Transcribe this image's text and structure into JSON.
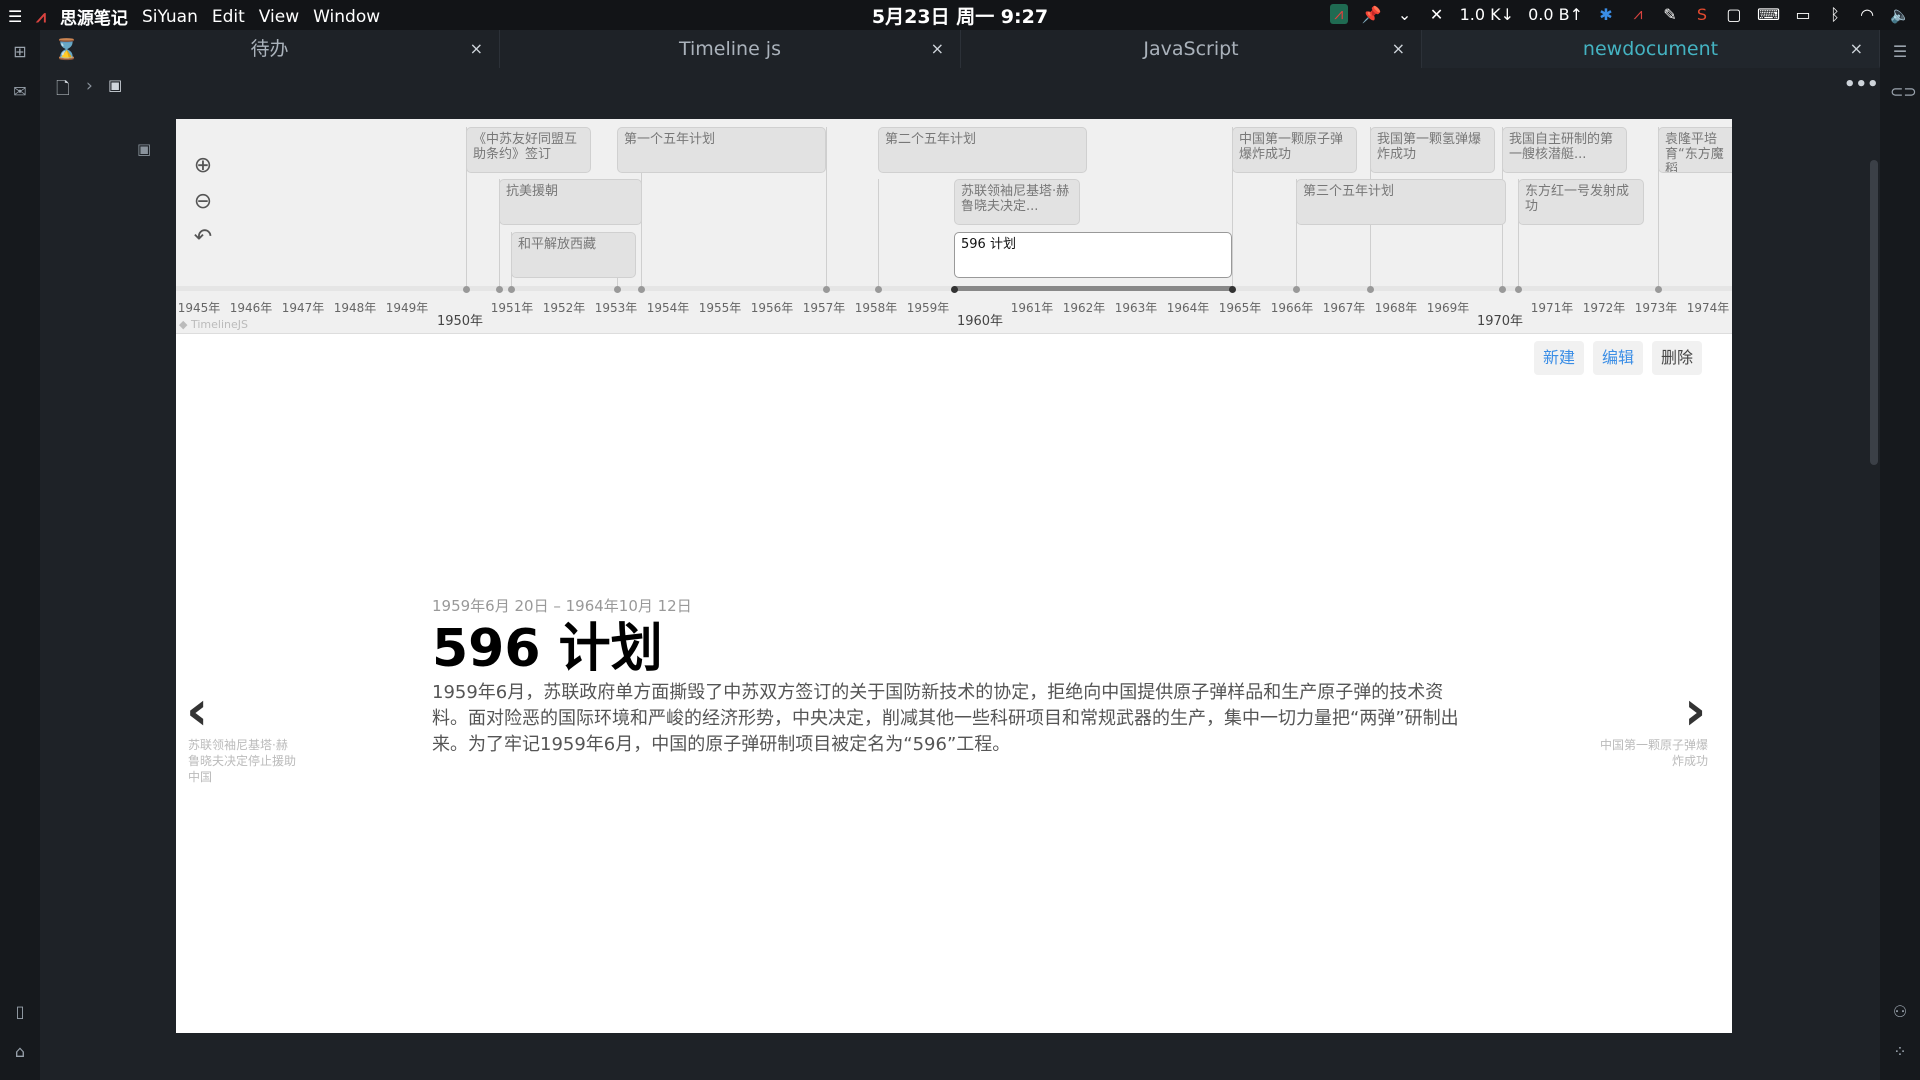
{
  "topbar": {
    "app_name": "思源笔记",
    "menu": [
      "SiYuan",
      "Edit",
      "View",
      "Window"
    ],
    "clock": "5月23日 周一  9:27",
    "net_down": "1.0 K↓",
    "net_up": "0.0 B↑"
  },
  "tabs": [
    {
      "label": "待办",
      "icon": "hourglass-icon"
    },
    {
      "label": "Timeline js"
    },
    {
      "label": "JavaScript"
    },
    {
      "label": "newdocument",
      "active": true
    }
  ],
  "timeline": {
    "markers": [
      {
        "text": "《中苏友好同盟互助条约》签订"
      },
      {
        "text": "第一个五年计划"
      },
      {
        "text": "抗美援朝"
      },
      {
        "text": "和平解放西藏"
      },
      {
        "text": "第二个五年计划"
      },
      {
        "text": "苏联领袖尼基塔·赫鲁晓夫决定..."
      },
      {
        "text": "596 计划"
      },
      {
        "text": "中国第一颗原子弹爆炸成功"
      },
      {
        "text": "我国第一颗氢弹爆炸成功"
      },
      {
        "text": "第三个五年计划"
      },
      {
        "text": "我国自主研制的第一艘核潜艇..."
      },
      {
        "text": "东方红一号发射成功"
      },
      {
        "text": "袁隆平培育“东方魔稻"
      }
    ],
    "years_small": [
      "1945年",
      "1946年",
      "1947年",
      "1948年",
      "1949年",
      "1951年",
      "1952年",
      "1953年",
      "1954年",
      "1955年",
      "1956年",
      "1957年",
      "1958年",
      "1959年",
      "1961年",
      "1962年",
      "1963年",
      "1964年",
      "1965年",
      "1966年",
      "1967年",
      "1968年",
      "1969年",
      "1971年",
      "1972年",
      "1973年",
      "1974年"
    ],
    "years_big": [
      "1950年",
      "1960年",
      "1970年"
    ],
    "credit": "TimelineJS"
  },
  "actions": {
    "new": "新建",
    "edit": "编辑",
    "delete": "删除"
  },
  "slide": {
    "date": "1959年6月 20日 – 1964年10月 12日",
    "title": "596 计划",
    "text": "1959年6月，苏联政府单方面撕毁了中苏双方签订的关于国防新技术的协定，拒绝向中国提供原子弹样品和生产原子弹的技术资料。面对险恶的国际环境和严峻的经济形势，中央决定，削减其他一些科研项目和常规武器的生产，集中一切力量把“两弹”研制出来。为了牢记1959年6月，中国的原子弹研制项目被定名为“596”工程。",
    "prev_label": "苏联领袖尼基塔·赫鲁晓夫决定停止援助中国",
    "next_label": "中国第一颗原子弹爆炸成功"
  },
  "colors": {
    "accent": "#44b3c2",
    "link": "#3b8ee6",
    "background": "#1e2227"
  }
}
